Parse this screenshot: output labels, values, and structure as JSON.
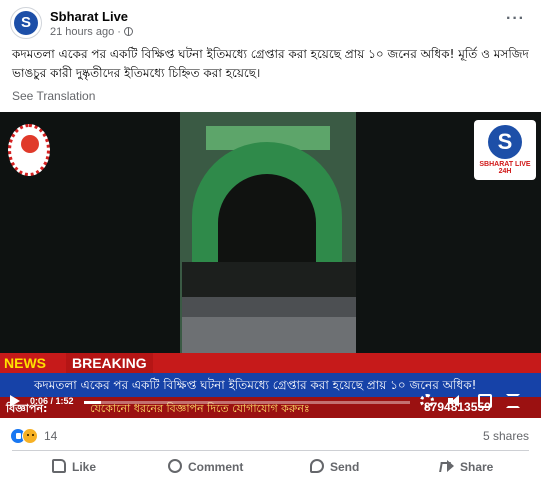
{
  "post": {
    "page_name": "Sbharat Live",
    "timestamp": "21 hours ago",
    "separator": "·",
    "privacy_icon": "globe-icon",
    "more_label": "···",
    "caption": "কদমতলা একের পর একটি বিক্ষিপ্ত ঘটনা ইতিমধ্যে গ্রেপ্তার করা হয়েছে প্রায় ১০ জনের অধিক! মূর্তি ও মসজিদ ভাঙচুর কারী দুষ্কৃতীদের ইতিমধ্যে চিহ্নিত করা হয়েছে।",
    "see_translation": "See Translation"
  },
  "video": {
    "logo_right_letter": "S",
    "logo_right_brand": "SBHARAT LIVE 24H",
    "news_tag": "NEWS",
    "breaking_label": "BREAKING",
    "headline": "কদমতলা একের পর একটি বিক্ষিপ্ত ঘটনা ইতিমধ্যে গ্রেপ্তার করা হয়েছে প্রায় ১০ জনের অধিক!",
    "ticker_label": "বিজ্ঞাপন:",
    "ticker_text": "যেকোনো ধরনের বিজ্ঞাপন দিতে যোগাযোগ করুনঃ",
    "ticker_phone": "8794813559",
    "current_time": "0:06",
    "duration": "1:52",
    "time_display": "0:06 / 1:52",
    "progress_fraction": 0.053,
    "colors": {
      "news_red": "#c61a1a",
      "headline_blue": "#1642a8",
      "ticker_red": "#9b1111"
    }
  },
  "engagement": {
    "reaction_icons": [
      "like-icon",
      "sad-icon"
    ],
    "reaction_count": "14",
    "shares": "5 shares"
  },
  "actions": {
    "like": "Like",
    "comment": "Comment",
    "send": "Send",
    "share": "Share"
  },
  "colors": {
    "accent": "#1877f2",
    "secondary_text": "#65676b"
  }
}
